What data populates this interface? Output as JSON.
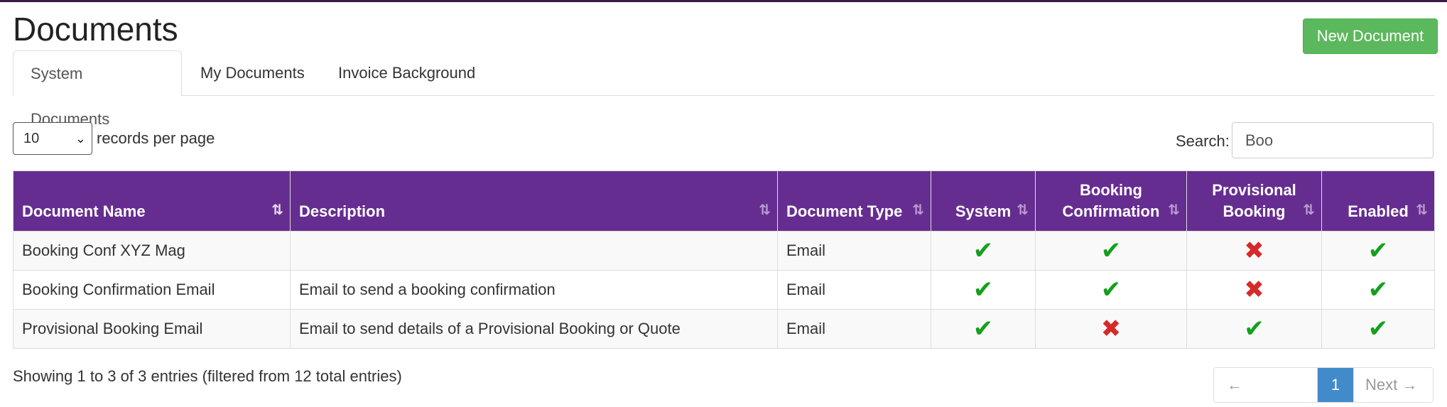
{
  "header": {
    "title": "Documents",
    "new_button": "New Document"
  },
  "tabs": [
    {
      "label": "System Documents",
      "active": true
    },
    {
      "label": "My Documents",
      "active": false
    },
    {
      "label": "Invoice Background",
      "active": false
    }
  ],
  "controls": {
    "page_length": "10",
    "page_length_suffix": "records per page",
    "search_label": "Search:",
    "search_value": "Boo"
  },
  "table": {
    "columns": [
      "Document Name",
      "Description",
      "Document Type",
      "System",
      "Booking Confirmation",
      "Provisional Booking",
      "Enabled"
    ],
    "rows": [
      {
        "name": "Booking Conf XYZ Mag",
        "description": "",
        "type": "Email",
        "system": true,
        "booking_confirmation": true,
        "provisional_booking": false,
        "enabled": true
      },
      {
        "name": "Booking Confirmation Email",
        "description": "Email to send a booking confirmation",
        "type": "Email",
        "system": true,
        "booking_confirmation": true,
        "provisional_booking": false,
        "enabled": true
      },
      {
        "name": "Provisional Booking Email",
        "description": "Email to send details of a Provisional Booking or Quote",
        "type": "Email",
        "system": true,
        "booking_confirmation": false,
        "provisional_booking": true,
        "enabled": true
      }
    ],
    "check_glyph": "✔",
    "cross_glyph": "✖"
  },
  "footer": {
    "info": "Showing 1 to 3 of 3 entries (filtered from 12 total entries)",
    "prev": "← Previous",
    "current_page": "1",
    "next": "Next →"
  },
  "colors": {
    "header_bg": "#662d91",
    "success": "#5cb85c",
    "check": "#14a01c",
    "cross": "#d62a2a",
    "pager_active": "#428bca"
  }
}
